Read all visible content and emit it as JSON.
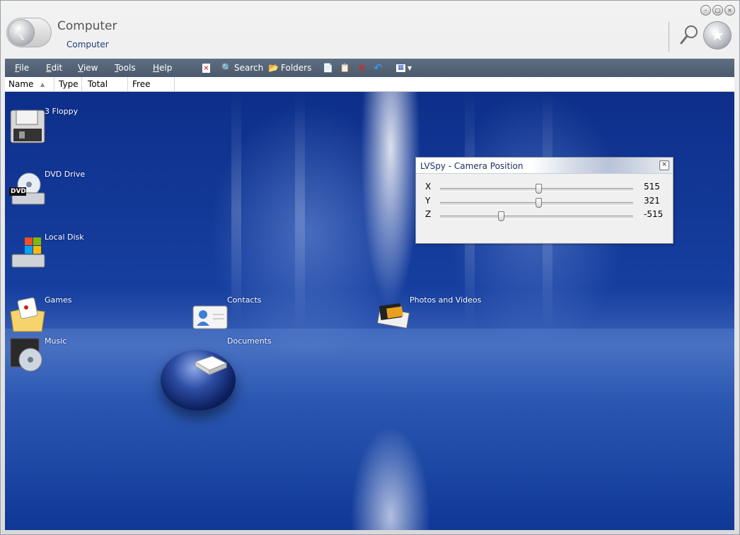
{
  "window": {
    "title": "Computer",
    "subtitle": "Computer"
  },
  "menu": {
    "items": [
      {
        "label": "File",
        "key": "F",
        "rest": "ile"
      },
      {
        "label": "Edit",
        "key": "E",
        "rest": "dit"
      },
      {
        "label": "View",
        "key": "V",
        "rest": "iew"
      },
      {
        "label": "Tools",
        "key": "T",
        "rest": "ools"
      },
      {
        "label": "Help",
        "key": "H",
        "rest": "elp"
      }
    ],
    "search_label": "Search",
    "folders_label": "Folders"
  },
  "columns": [
    "Name",
    "Type",
    "Total Size",
    "Free Space"
  ],
  "items": [
    {
      "label": "3 Floppy",
      "icon": "floppy-drive-icon"
    },
    {
      "label": "DVD Drive",
      "icon": "dvd-drive-icon",
      "badge": "DVD"
    },
    {
      "label": "Local Disk",
      "icon": "local-disk-icon"
    },
    {
      "label": "Games",
      "icon": "games-folder-icon"
    },
    {
      "label": "Contacts",
      "icon": "contacts-folder-icon"
    },
    {
      "label": "Photos and Videos",
      "icon": "photos-videos-icon"
    },
    {
      "label": "Music",
      "icon": "music-folder-icon"
    },
    {
      "label": "Documents",
      "icon": "documents-icon"
    }
  ],
  "camera_dialog": {
    "title": "LVSpy - Camera Position",
    "rows": [
      {
        "label": "X",
        "value": "515",
        "position": 0.51
      },
      {
        "label": "Y",
        "value": "321",
        "position": 0.51
      },
      {
        "label": "Z",
        "value": "-515",
        "position": 0.31
      }
    ]
  },
  "colors": {
    "menubar": "#53637a",
    "desktop_blue": "#163fa0",
    "dialog_title_text": "#1a2f5e"
  }
}
